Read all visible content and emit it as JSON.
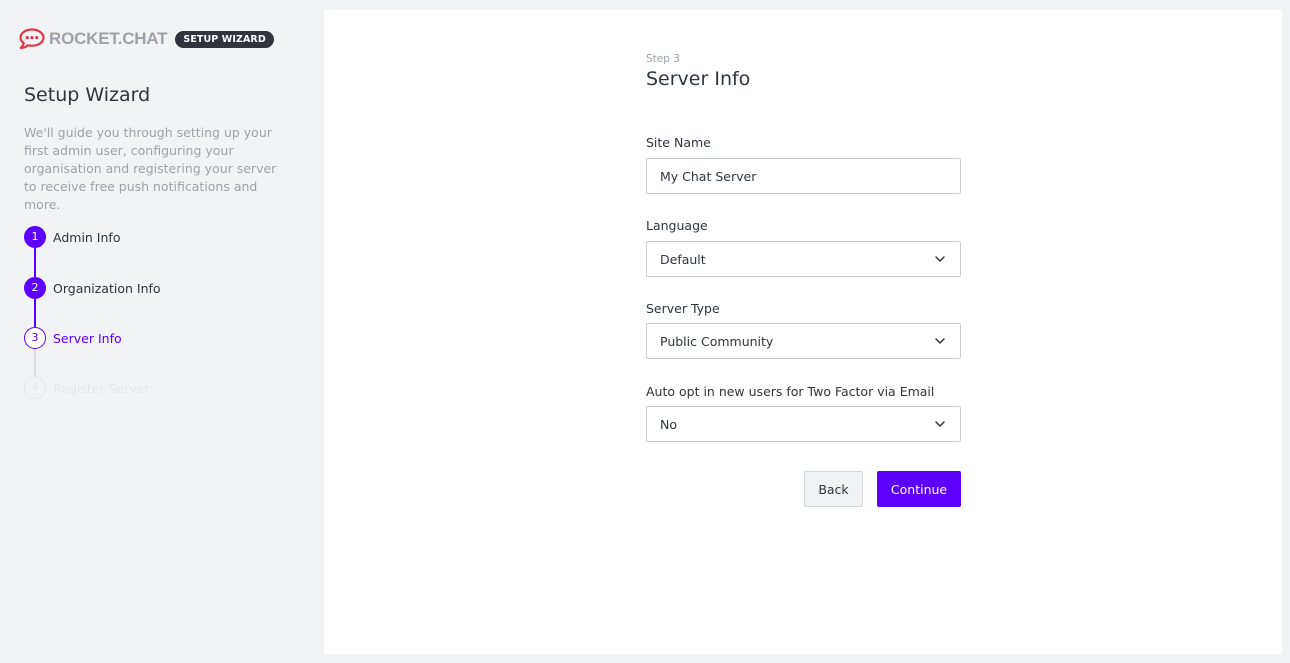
{
  "brand": {
    "name": "ROCKET.CHAT",
    "badge": "SETUP WIZARD",
    "logo_icon": "rocketchat-logo-icon",
    "logo_color": "#e0364d"
  },
  "sidebar": {
    "title": "Setup Wizard",
    "description": "We'll guide you through setting up your first admin user, configuring your organisation and registering your server to receive free push notifications and more.",
    "steps": [
      {
        "number": "1",
        "label": "Admin Info",
        "state": "done"
      },
      {
        "number": "2",
        "label": "Organization Info",
        "state": "done"
      },
      {
        "number": "3",
        "label": "Server Info",
        "state": "current"
      },
      {
        "number": "4",
        "label": "Register Server",
        "state": "pending"
      }
    ]
  },
  "form": {
    "step_indicator": "Step 3",
    "title": "Server Info",
    "site_name": {
      "label": "Site Name",
      "value": "My Chat Server"
    },
    "language": {
      "label": "Language",
      "value": "Default"
    },
    "server_type": {
      "label": "Server Type",
      "value": "Public Community"
    },
    "two_factor": {
      "label": "Auto opt in new users for Two Factor via Email",
      "value": "No"
    },
    "back_label": "Back",
    "continue_label": "Continue"
  },
  "colors": {
    "accent": "#5c00ff",
    "background": "#f2f3f5",
    "panel": "#ffffff",
    "text": "#2f343d",
    "muted": "#9ea2a8",
    "border": "#cbced1"
  }
}
